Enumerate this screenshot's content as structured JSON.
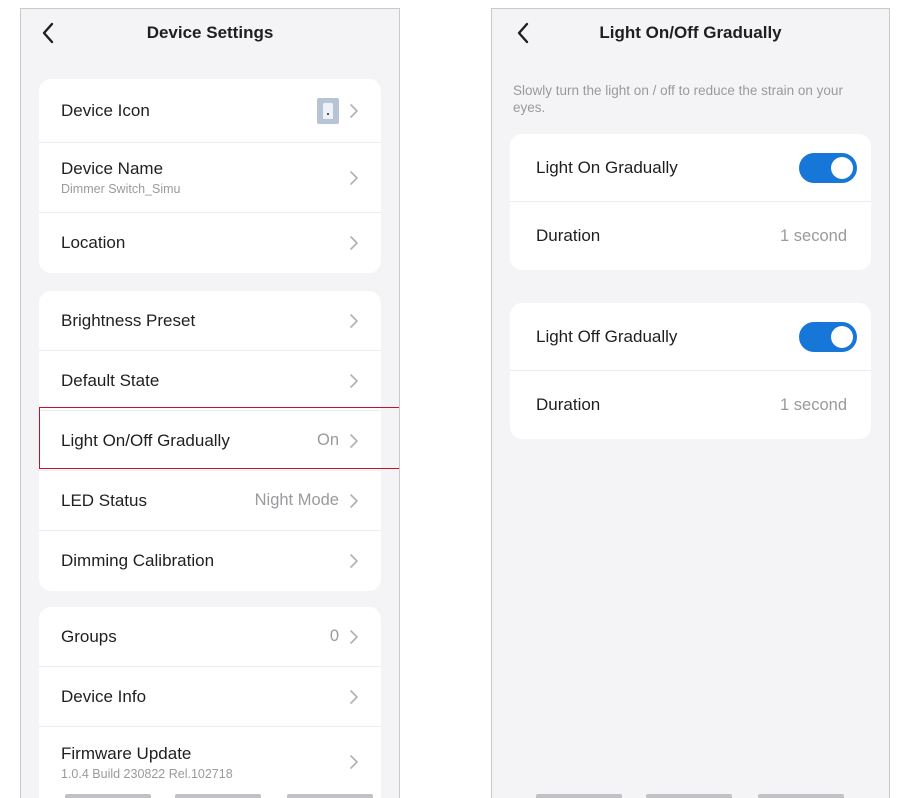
{
  "left": {
    "title": "Device Settings",
    "group1": [
      {
        "label": "Device Icon",
        "sub": "",
        "value": ""
      },
      {
        "label": "Device Name",
        "sub": "Dimmer Switch_Simu",
        "value": ""
      },
      {
        "label": "Location",
        "sub": "",
        "value": ""
      }
    ],
    "group2": [
      {
        "label": "Brightness Preset",
        "sub": "",
        "value": ""
      },
      {
        "label": "Default State",
        "sub": "",
        "value": ""
      },
      {
        "label": "Light On/Off Gradually",
        "sub": "",
        "value": "On"
      },
      {
        "label": "LED Status",
        "sub": "",
        "value": "Night Mode"
      },
      {
        "label": "Dimming Calibration",
        "sub": "",
        "value": ""
      }
    ],
    "group3": [
      {
        "label": "Groups",
        "sub": "",
        "value": "0"
      },
      {
        "label": "Device Info",
        "sub": "",
        "value": ""
      },
      {
        "label": "Firmware Update",
        "sub": "1.0.4 Build 230822 Rel.102718",
        "value": ""
      }
    ]
  },
  "right": {
    "title": "Light On/Off Gradually",
    "description": "Slowly turn the light on / off to reduce the strain on your eyes.",
    "on_card": {
      "toggle_label": "Light On Gradually",
      "toggle_state": true,
      "duration_label": "Duration",
      "duration_value": "1 second"
    },
    "off_card": {
      "toggle_label": "Light Off Gradually",
      "toggle_state": true,
      "duration_label": "Duration",
      "duration_value": "1 second"
    }
  },
  "colors": {
    "accent": "#1677d8",
    "highlight": "#c8102e",
    "background": "#f4f4f6",
    "muted_text": "#9a9a9e"
  },
  "icons": {
    "back": "chevron-left-icon",
    "row_arrow": "chevron-right-icon",
    "device_icon": "device-switch-icon"
  }
}
